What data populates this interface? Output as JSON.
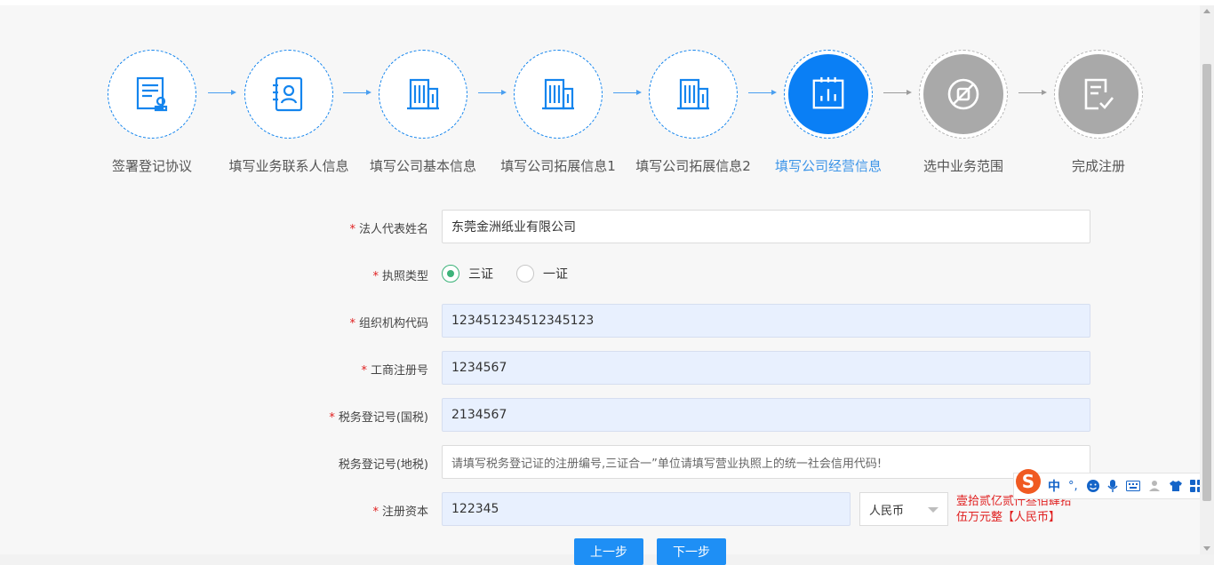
{
  "steps": [
    {
      "label": "签署登记协议",
      "icon": "document-stamp-icon",
      "state": "done"
    },
    {
      "label": "填写业务联系人信息",
      "icon": "contact-book-icon",
      "state": "done"
    },
    {
      "label": "填写公司基本信息",
      "icon": "building-icon",
      "state": "done"
    },
    {
      "label": "填写公司拓展信息1",
      "icon": "building-icon",
      "state": "done"
    },
    {
      "label": "填写公司拓展信息2",
      "icon": "building-icon",
      "state": "done"
    },
    {
      "label": "填写公司经营信息",
      "icon": "chart-board-icon",
      "state": "active"
    },
    {
      "label": "选中业务范围",
      "icon": "block-icon",
      "state": "pending"
    },
    {
      "label": "完成注册",
      "icon": "document-check-icon",
      "state": "pending"
    }
  ],
  "form": {
    "required_mark": "*",
    "legal_rep": {
      "label": "法人代表姓名",
      "value": "东莞金洲纸业有限公司"
    },
    "license_type": {
      "label": "执照类型",
      "options": [
        "三证",
        "一证"
      ],
      "selected": "三证"
    },
    "org_code": {
      "label": "组织机构代码",
      "value": "123451234512345123"
    },
    "biz_reg": {
      "label": "工商注册号",
      "value": "1234567"
    },
    "tax_national": {
      "label": "税务登记号(国税)",
      "value": "2134567"
    },
    "tax_local": {
      "label": "税务登记号(地税)",
      "placeholder": "请填写税务登记证的注册编号,三证合一”单位请填写营业执照上的统一社会信用代码!"
    },
    "capital": {
      "label": "注册资本",
      "value": "122345",
      "currency": "人民币",
      "amount_line1": "壹拾贰亿贰仟叁佰肆拾",
      "amount_line2": "伍万元整【人民币】"
    }
  },
  "buttons": {
    "prev": "上一步",
    "next": "下一步"
  },
  "ime": {
    "logo": "S",
    "lang": "中",
    "punct": "°,"
  },
  "colors": {
    "primary": "#0a7ff5",
    "active_text": "#3d95e8",
    "pending": "#a9a9a9",
    "required": "#e02020",
    "radio_checked": "#3db37a"
  }
}
